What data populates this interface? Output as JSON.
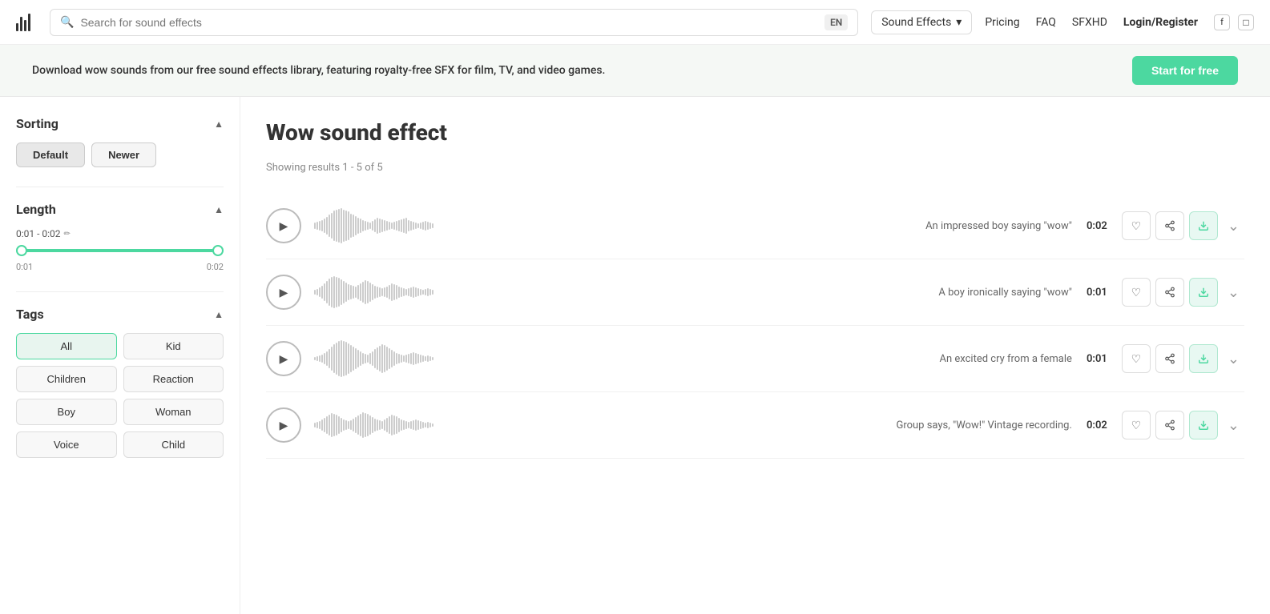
{
  "header": {
    "logo_label": "Audio",
    "search_placeholder": "Search for sound effects",
    "lang": "EN",
    "sound_effects_label": "Sound Effects",
    "nav": [
      {
        "id": "pricing",
        "label": "Pricing"
      },
      {
        "id": "faq",
        "label": "FAQ"
      },
      {
        "id": "sfxhd",
        "label": "SFXHD"
      },
      {
        "id": "login",
        "label": "Login/Register",
        "bold": true
      }
    ],
    "social": [
      "f",
      "◻"
    ]
  },
  "banner": {
    "text": "Download wow sounds from our free sound effects library, featuring royalty-free SFX for film, TV, and video games.",
    "cta": "Start for free"
  },
  "sidebar": {
    "sorting": {
      "title": "Sorting",
      "buttons": [
        {
          "id": "default",
          "label": "Default",
          "active": true
        },
        {
          "id": "newer",
          "label": "Newer",
          "active": false
        }
      ]
    },
    "length": {
      "title": "Length",
      "range": "0:01 - 0:02",
      "min_label": "0:01",
      "max_label": "0:02"
    },
    "tags": {
      "title": "Tags",
      "items": [
        {
          "id": "all",
          "label": "All",
          "active": true
        },
        {
          "id": "kid",
          "label": "Kid",
          "active": false
        },
        {
          "id": "children",
          "label": "Children",
          "active": false
        },
        {
          "id": "reaction",
          "label": "Reaction",
          "active": false
        },
        {
          "id": "boy",
          "label": "Boy",
          "active": false
        },
        {
          "id": "woman",
          "label": "Woman",
          "active": false
        },
        {
          "id": "voice",
          "label": "Voice",
          "active": false
        },
        {
          "id": "child",
          "label": "Child",
          "active": false
        }
      ]
    }
  },
  "main": {
    "title": "Wow sound effect",
    "results_text": "Showing results 1 - 5 of 5",
    "sounds": [
      {
        "id": 1,
        "description": "An impressed boy saying \"wow\"",
        "duration": "0:02",
        "waveform_heights": [
          8,
          10,
          12,
          14,
          18,
          22,
          28,
          32,
          38,
          40,
          42,
          44,
          40,
          38,
          36,
          30,
          28,
          24,
          20,
          18,
          14,
          12,
          10,
          8,
          12,
          16,
          20,
          18,
          16,
          14,
          12,
          10,
          8,
          10,
          12,
          14,
          16,
          18,
          20,
          14,
          12,
          10,
          8,
          6,
          8,
          10,
          12,
          10,
          8,
          6
        ]
      },
      {
        "id": 2,
        "description": "A boy ironically saying \"wow\"",
        "duration": "0:01",
        "waveform_heights": [
          6,
          8,
          12,
          16,
          22,
          28,
          34,
          38,
          40,
          38,
          36,
          32,
          28,
          24,
          20,
          18,
          16,
          14,
          18,
          22,
          26,
          30,
          28,
          24,
          20,
          16,
          14,
          12,
          10,
          12,
          14,
          18,
          22,
          20,
          18,
          14,
          12,
          10,
          8,
          10,
          12,
          14,
          12,
          10,
          8,
          6,
          8,
          10,
          8,
          6
        ]
      },
      {
        "id": 3,
        "description": "An excited cry from a female",
        "duration": "0:01",
        "waveform_heights": [
          4,
          6,
          8,
          10,
          14,
          18,
          24,
          30,
          36,
          40,
          44,
          46,
          44,
          42,
          38,
          34,
          30,
          26,
          22,
          18,
          14,
          12,
          10,
          14,
          18,
          24,
          28,
          32,
          36,
          34,
          30,
          26,
          22,
          18,
          14,
          12,
          10,
          8,
          10,
          12,
          14,
          16,
          14,
          12,
          10,
          8,
          6,
          8,
          6,
          4
        ]
      },
      {
        "id": 4,
        "description": "Group says, \"Wow!\" Vintage recording.",
        "duration": "0:02",
        "waveform_heights": [
          6,
          8,
          10,
          14,
          18,
          22,
          26,
          30,
          28,
          26,
          22,
          18,
          14,
          12,
          10,
          12,
          16,
          20,
          24,
          28,
          32,
          30,
          28,
          24,
          20,
          16,
          14,
          12,
          10,
          14,
          18,
          22,
          26,
          24,
          22,
          18,
          14,
          12,
          10,
          8,
          10,
          12,
          14,
          12,
          10,
          8,
          6,
          8,
          6,
          4
        ]
      }
    ]
  }
}
